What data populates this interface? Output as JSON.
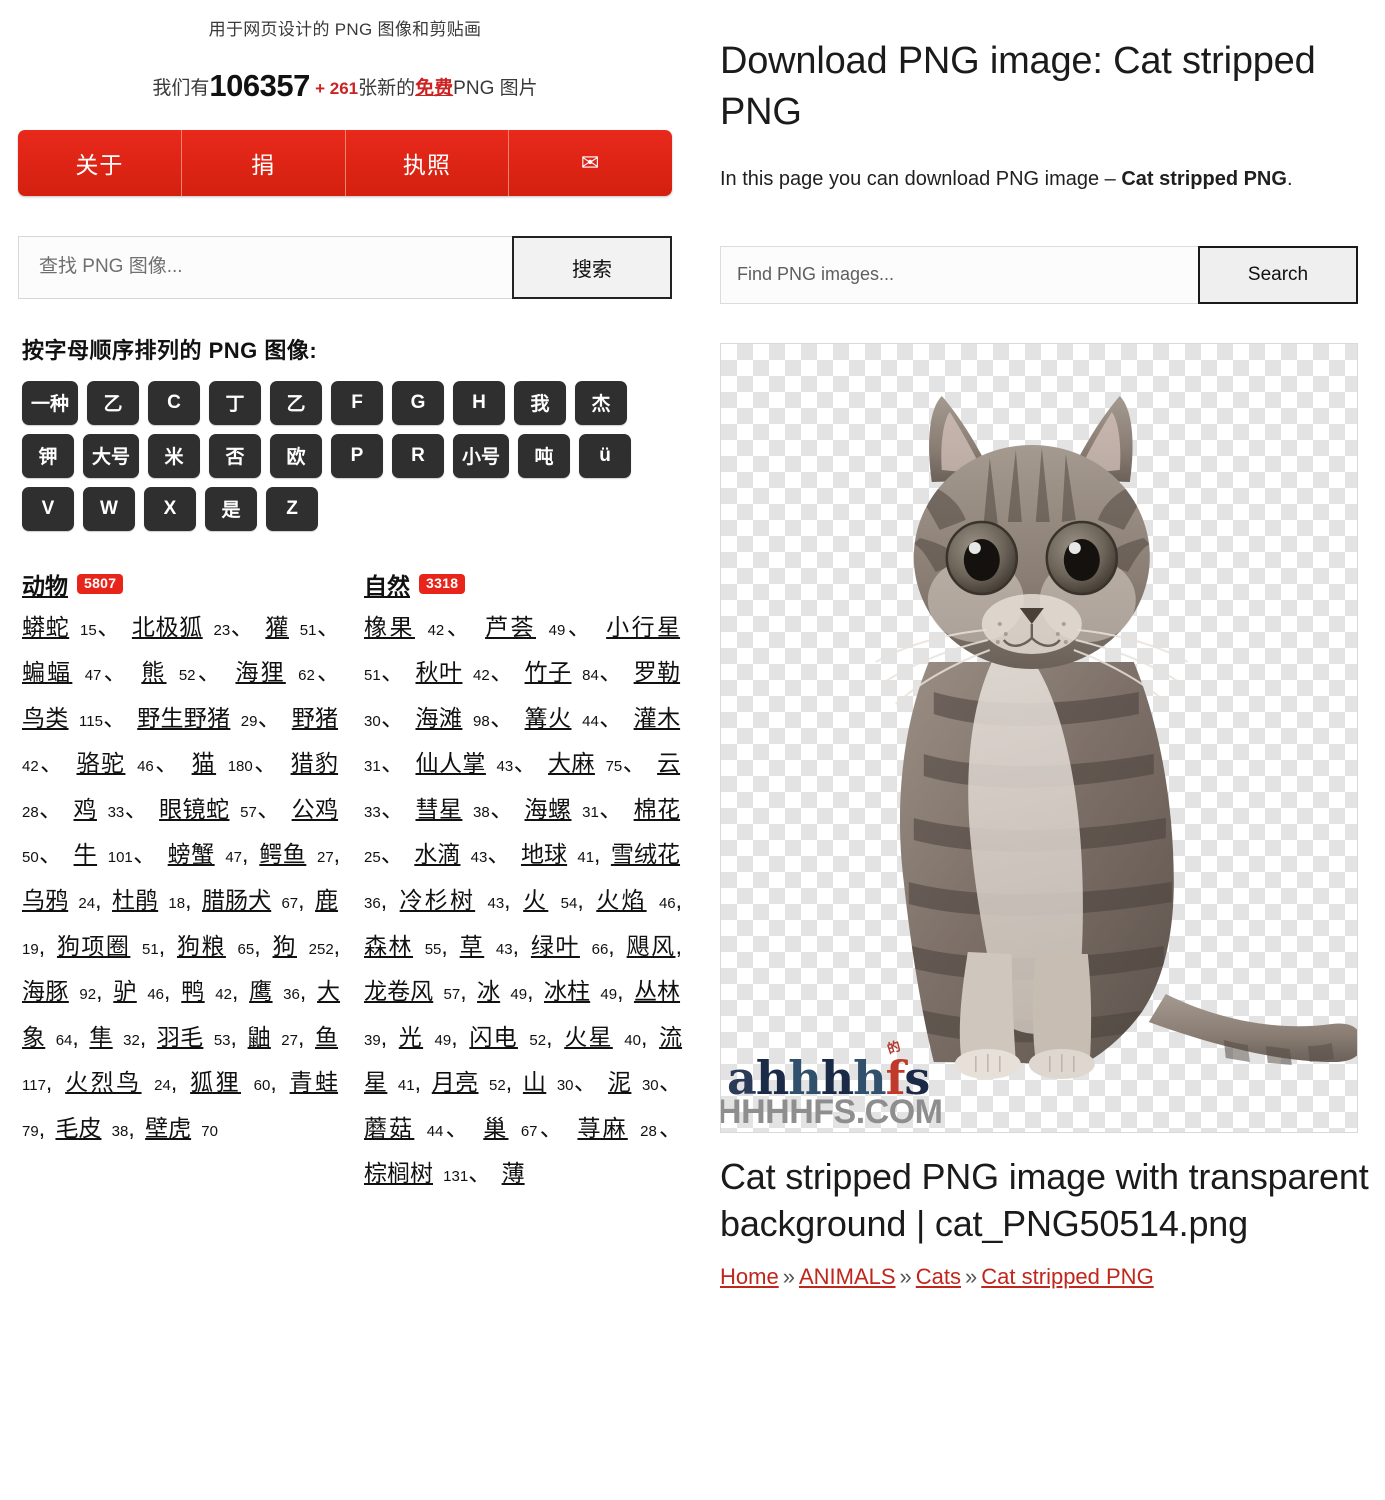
{
  "left": {
    "tagline": "用于网页设计的 PNG 图像和剪贴画",
    "counter": {
      "prefix": "我们有",
      "total": "106357",
      "new": "+ 261",
      "mid": "张新的",
      "free": "免费",
      "suffix": "PNG 图片"
    },
    "nav": [
      {
        "label": "关于",
        "icon": "none"
      },
      {
        "label": "捐",
        "icon": "none"
      },
      {
        "label": "执照",
        "icon": "none"
      },
      {
        "label": "✉",
        "icon": "envelope-icon"
      }
    ],
    "search": {
      "placeholder": "查找 PNG 图像...",
      "value": "",
      "button": "搜索"
    },
    "alpha_title": "按字母顺序排列的 PNG 图像:",
    "alpha_buttons": [
      "一种",
      "乙",
      "C",
      "丁",
      "乙",
      "F",
      "G",
      "H",
      "我",
      "杰",
      "钾",
      "大号",
      "米",
      "否",
      "欧",
      "P",
      "R",
      "小号",
      "吨",
      "ü",
      "V",
      "W",
      "X",
      "是",
      "Z"
    ],
    "categories": [
      {
        "name": "动物",
        "count": "5807",
        "items": [
          {
            "label": "蟒蛇",
            "num": "15",
            "sep": "、"
          },
          {
            "label": "北极狐",
            "num": "23",
            "sep": "、"
          },
          {
            "label": "獾",
            "num": "51",
            "sep": "、"
          },
          {
            "label": "蝙蝠",
            "num": "47",
            "sep": "、"
          },
          {
            "label": "熊",
            "num": "52",
            "sep": "、"
          },
          {
            "label": "海狸",
            "num": "62",
            "sep": "、"
          },
          {
            "label": "鸟类",
            "num": "115",
            "sep": "、"
          },
          {
            "label": "野生野猪",
            "num": "29",
            "sep": "、"
          },
          {
            "label": "野猪",
            "num": "42",
            "sep": "、"
          },
          {
            "label": "骆驼",
            "num": "46",
            "sep": "、"
          },
          {
            "label": "猫",
            "num": "180",
            "sep": "、"
          },
          {
            "label": "猎豹",
            "num": "28",
            "sep": "、"
          },
          {
            "label": "鸡",
            "num": "33",
            "sep": "、"
          },
          {
            "label": "眼镜蛇",
            "num": "57",
            "sep": "、"
          },
          {
            "label": "公鸡",
            "num": "50",
            "sep": "、"
          },
          {
            "label": "牛",
            "num": "101",
            "sep": "、"
          },
          {
            "label": "螃蟹",
            "num": "47",
            "sep": ","
          },
          {
            "label": "鳄鱼",
            "num": "27",
            "sep": ","
          },
          {
            "label": "乌鸦",
            "num": "24",
            "sep": ","
          },
          {
            "label": "杜鹃",
            "num": "18",
            "sep": ","
          },
          {
            "label": "腊肠犬",
            "num": "67",
            "sep": ","
          },
          {
            "label": "鹿",
            "num": "19",
            "sep": ","
          },
          {
            "label": "狗项圈",
            "num": "51",
            "sep": ","
          },
          {
            "label": "狗粮",
            "num": "65",
            "sep": ","
          },
          {
            "label": "狗",
            "num": "252",
            "sep": ","
          },
          {
            "label": "海豚",
            "num": "92",
            "sep": ","
          },
          {
            "label": "驴",
            "num": "46",
            "sep": ","
          },
          {
            "label": "鸭",
            "num": "42",
            "sep": ","
          },
          {
            "label": "鹰",
            "num": "36",
            "sep": ","
          },
          {
            "label": "大象",
            "num": "64",
            "sep": ","
          },
          {
            "label": "隼",
            "num": "32",
            "sep": ","
          },
          {
            "label": "羽毛",
            "num": "53",
            "sep": ","
          },
          {
            "label": "鼬",
            "num": "27",
            "sep": ","
          },
          {
            "label": "鱼",
            "num": "117",
            "sep": ","
          },
          {
            "label": "火烈鸟",
            "num": "24",
            "sep": ","
          },
          {
            "label": "狐狸",
            "num": "60",
            "sep": ","
          },
          {
            "label": "青蛙",
            "num": "79",
            "sep": ","
          },
          {
            "label": "毛皮",
            "num": "38",
            "sep": ","
          },
          {
            "label": "壁虎",
            "num": "70",
            "sep": ""
          }
        ]
      },
      {
        "name": "自然",
        "count": "3318",
        "items": [
          {
            "label": "橡果",
            "num": "42",
            "sep": "、"
          },
          {
            "label": "芦荟",
            "num": "49",
            "sep": "、"
          },
          {
            "label": "小行星",
            "num": "51",
            "sep": "、"
          },
          {
            "label": "秋叶",
            "num": "42",
            "sep": "、"
          },
          {
            "label": "竹子",
            "num": "84",
            "sep": "、"
          },
          {
            "label": "罗勒",
            "num": "30",
            "sep": "、"
          },
          {
            "label": "海滩",
            "num": "98",
            "sep": "、"
          },
          {
            "label": "篝火",
            "num": "44",
            "sep": "、"
          },
          {
            "label": "灌木",
            "num": "31",
            "sep": "、"
          },
          {
            "label": "仙人掌",
            "num": "43",
            "sep": "、"
          },
          {
            "label": "大麻",
            "num": "75",
            "sep": "、"
          },
          {
            "label": "云",
            "num": "33",
            "sep": "、"
          },
          {
            "label": "彗星",
            "num": "38",
            "sep": "、"
          },
          {
            "label": "海螺",
            "num": "31",
            "sep": "、"
          },
          {
            "label": "棉花",
            "num": "25",
            "sep": "、"
          },
          {
            "label": "水滴",
            "num": "43",
            "sep": "、"
          },
          {
            "label": "地球",
            "num": "41",
            "sep": ","
          },
          {
            "label": "雪绒花",
            "num": "36",
            "sep": ","
          },
          {
            "label": "冷杉树",
            "num": "43",
            "sep": ","
          },
          {
            "label": "火",
            "num": "54",
            "sep": ","
          },
          {
            "label": "火焰",
            "num": "46",
            "sep": ","
          },
          {
            "label": "森林",
            "num": "55",
            "sep": ","
          },
          {
            "label": "草",
            "num": "43",
            "sep": ","
          },
          {
            "label": "绿叶",
            "num": "66",
            "sep": ","
          },
          {
            "label": "飓风, 龙卷风",
            "num": "57",
            "sep": ","
          },
          {
            "label": "冰",
            "num": "49",
            "sep": ","
          },
          {
            "label": "冰柱",
            "num": "49",
            "sep": ","
          },
          {
            "label": "丛林",
            "num": "39",
            "sep": ","
          },
          {
            "label": "光",
            "num": "49",
            "sep": ","
          },
          {
            "label": "闪电",
            "num": "52",
            "sep": ","
          },
          {
            "label": "火星",
            "num": "40",
            "sep": ","
          },
          {
            "label": "流星",
            "num": "41",
            "sep": ","
          },
          {
            "label": "月亮",
            "num": "52",
            "sep": ","
          },
          {
            "label": "山",
            "num": "30",
            "sep": "、"
          },
          {
            "label": "泥",
            "num": "30",
            "sep": "、"
          },
          {
            "label": "蘑菇",
            "num": "44",
            "sep": "、"
          },
          {
            "label": "巢",
            "num": "67",
            "sep": "、"
          },
          {
            "label": "荨麻",
            "num": "28",
            "sep": "、"
          },
          {
            "label": "棕榈树",
            "num": "131",
            "sep": "、"
          },
          {
            "label": "薄",
            "num": "",
            "sep": ""
          }
        ]
      }
    ]
  },
  "right": {
    "title": "Download PNG image: Cat stripped PNG",
    "subtitle_prefix": "In this page you can download PNG image – ",
    "subtitle_bold": "Cat stripped PNG",
    "subtitle_suffix": ".",
    "search": {
      "placeholder": "Find PNG images...",
      "value": "",
      "button": "Search"
    },
    "image": {
      "alt": "Cat stripped PNG image with transparent background",
      "watermark_logo": "ahhhhfs",
      "watermark_domain": "AHHHHFS.COM",
      "watermark_star": "的"
    },
    "caption": "Cat stripped PNG image with transparent background | cat_PNG50514.png",
    "breadcrumb": [
      {
        "label": "Home"
      },
      {
        "label": "ANIMALS"
      },
      {
        "label": "Cats"
      },
      {
        "label": "Cat stripped PNG"
      }
    ],
    "breadcrumb_sep": "»"
  },
  "colors": {
    "nav_red": "#e8291c",
    "badge_red": "#e8251a",
    "link_red": "#c0261b",
    "alpha_dark": "#2f2f2f"
  }
}
